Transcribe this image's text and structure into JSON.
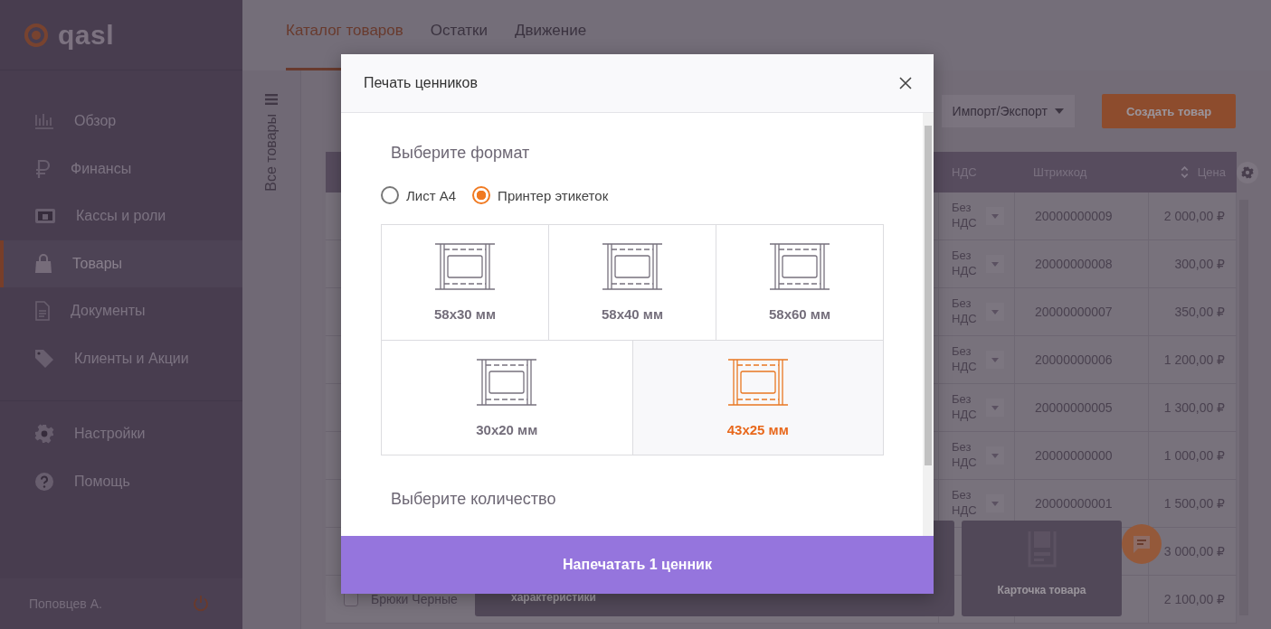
{
  "sidebar": {
    "logo": "qasl",
    "nav": [
      {
        "label": "Обзор",
        "selected": false
      },
      {
        "label": "Финансы",
        "selected": false
      },
      {
        "label": "Кассы и роли",
        "selected": false
      },
      {
        "label": "Товары",
        "selected": true
      },
      {
        "label": "Документы",
        "selected": false
      },
      {
        "label": "Клиенты и Акции",
        "selected": false
      }
    ],
    "nav_secondary": [
      {
        "label": "Настройки",
        "selected": false
      },
      {
        "label": "Помощь",
        "selected": false
      }
    ],
    "user": "Поповцев А."
  },
  "tabs": [
    {
      "label": "Каталог товаров",
      "selected": true
    },
    {
      "label": "Остатки",
      "selected": false
    },
    {
      "label": "Движение",
      "selected": false
    }
  ],
  "side_rail": {
    "label": "Все товары"
  },
  "toolbar": {
    "import_export": "Импорт/Экспорт",
    "create_button": "Создать товар"
  },
  "table": {
    "columns": [
      "НДС",
      "Штрихкод",
      "Цена"
    ],
    "rows": [
      {
        "vat": "Без НДС",
        "barcode": "20000000009",
        "price": "2 000,00 ₽"
      },
      {
        "vat": "Без НДС",
        "barcode": "20000000008",
        "price": "300,00 ₽"
      },
      {
        "vat": "Без НДС",
        "barcode": "20000000007",
        "price": "350,00 ₽"
      },
      {
        "vat": "Без НДС",
        "barcode": "20000000006",
        "price": "1 200,00 ₽"
      },
      {
        "vat": "Без НДС",
        "barcode": "20000000005",
        "price": "1 300,00 ₽"
      },
      {
        "vat": "Без НДС",
        "barcode": "20000000000",
        "price": "1 000,00 ₽"
      },
      {
        "vat": "Без НДС",
        "barcode": "20000000001",
        "price": "1 500,00 ₽"
      },
      {
        "price": "3 000,00 ₽"
      },
      {
        "name": "Брюки Черные",
        "checked": false,
        "price": "2 100,00 ₽"
      }
    ]
  },
  "action_popups": [
    {
      "label": "характеристики"
    },
    {
      "label": "Карточка товара"
    }
  ],
  "modal": {
    "title": "Печать ценников",
    "format_heading": "Выберите формат",
    "modes": [
      {
        "label": "Лист А4",
        "selected": false
      },
      {
        "label": "Принтер этикеток",
        "selected": true
      }
    ],
    "format_rows": [
      {
        "options": [
          {
            "label": "58x30 мм",
            "selected": false
          },
          {
            "label": "58x40 мм",
            "selected": false
          },
          {
            "label": "58x60 мм",
            "selected": false
          }
        ]
      },
      {
        "options": [
          {
            "label": "30x20 мм",
            "selected": false
          },
          {
            "label": "43x25 мм",
            "selected": true
          }
        ]
      }
    ],
    "quantity_heading": "Выберите количество",
    "print_button": "Напечатать 1 ценник"
  }
}
